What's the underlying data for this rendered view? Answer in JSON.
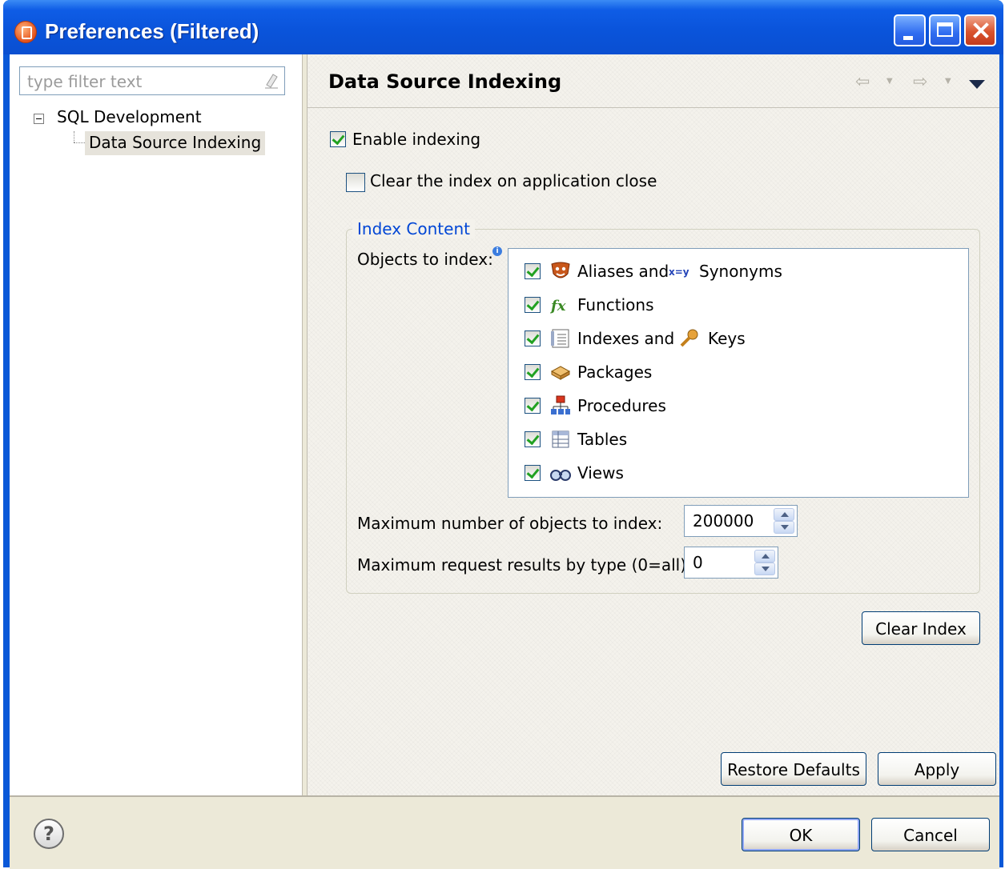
{
  "window": {
    "title": "Preferences (Filtered)"
  },
  "sidebar": {
    "filter_placeholder": "type filter text",
    "tree": {
      "root_label": "SQL Development",
      "child_label": "Data Source Indexing"
    }
  },
  "page": {
    "title": "Data Source Indexing",
    "enable_indexing_label": "Enable indexing",
    "enable_indexing_checked": true,
    "clear_on_close_label": "Clear the index on application close",
    "clear_on_close_checked": false,
    "group_title": "Index Content",
    "objects_label": "Objects to index:",
    "objects": [
      {
        "label": "Aliases and",
        "label2": "Synonyms",
        "icon": "aliases-icon",
        "icon2": "synonyms-icon",
        "checked": true
      },
      {
        "label": "Functions",
        "icon": "function-icon",
        "checked": true
      },
      {
        "label": "Indexes and",
        "label2": "Keys",
        "icon": "index-icon",
        "icon2": "key-icon",
        "checked": true
      },
      {
        "label": "Packages",
        "icon": "package-icon",
        "checked": true
      },
      {
        "label": "Procedures",
        "icon": "procedure-icon",
        "checked": true
      },
      {
        "label": "Tables",
        "icon": "table-icon",
        "checked": true
      },
      {
        "label": "Views",
        "icon": "binoculars-icon",
        "checked": true
      }
    ],
    "max_objects_label": "Maximum number of objects to index:",
    "max_objects_value": "200000",
    "max_results_label": "Maximum request results by type (0=all):",
    "max_results_value": "0",
    "clear_index_button": "Clear Index",
    "restore_defaults_button": "Restore Defaults",
    "apply_button": "Apply"
  },
  "footer": {
    "ok_button": "OK",
    "cancel_button": "Cancel"
  },
  "colors": {
    "titlebar": "#0a54db",
    "group_title": "#0046d5",
    "check": "#21a121"
  }
}
